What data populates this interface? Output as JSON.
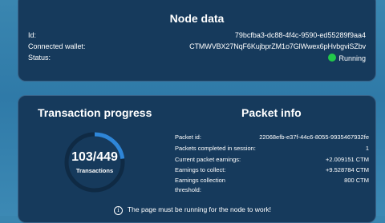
{
  "node": {
    "title": "Node data",
    "id_label": "Id:",
    "id_value": "79bcfba3-dc88-4f4c-9590-ed55289f9aa4",
    "wallet_label": "Connected wallet:",
    "wallet_value": "CTMWVBX27NqF6KujbprZM1o7GlWwex6pHvbgviSZbv",
    "status_label": "Status:",
    "status_value": "Running",
    "status_color": "#22c84a"
  },
  "transactions": {
    "title": "Transaction progress",
    "count": "103/449",
    "label": "Transactions",
    "progress_fraction": 0.2294
  },
  "packet": {
    "title": "Packet info",
    "rows": [
      {
        "label": "Packet id:",
        "value": "22068efb-e37f-44c6-8055-9935467932fe"
      },
      {
        "label": "Packets completed in session:",
        "value": "1"
      },
      {
        "label": "Current packet earnings:",
        "value": "+2.009151 CTM"
      },
      {
        "label": "Earnings to collect:",
        "value": "+9.528784 CTM"
      },
      {
        "label": "Earnings collection",
        "value": "800 CTM"
      },
      {
        "label": "threshold:",
        "value": ""
      }
    ]
  },
  "footer": {
    "icon": "info-icon",
    "text": "The page must be running for the node to work!"
  },
  "colors": {
    "card": "#163a5c",
    "progress": "#2e86d8",
    "progress_track": "#0f2a44"
  }
}
